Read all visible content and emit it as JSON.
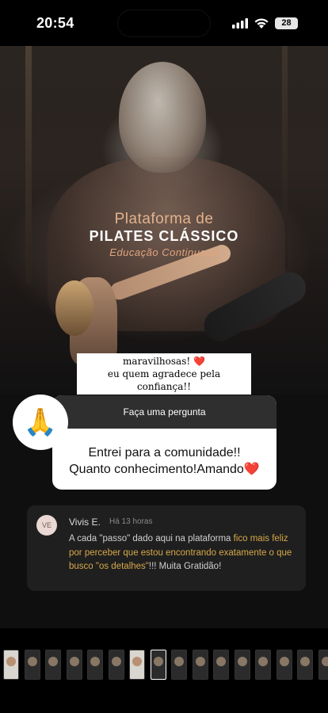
{
  "status_bar": {
    "time": "20:54",
    "battery": "28"
  },
  "story": {
    "brand": {
      "line1": "Plataforma de",
      "line2": "PILATES CLÁSSICO",
      "line3": "Educação Continuada"
    },
    "caption": {
      "line1": "maravilhosas! ❤️",
      "line2": "eu quem agradece pela confiança!!"
    },
    "question_sticker": {
      "avatar_emoji": "🙏",
      "header": "Faça uma pergunta",
      "answer_line1": "Entrei para a comunidade!!",
      "answer_line2": "Quanto conhecimento!Amando❤️"
    },
    "comment": {
      "avatar_initials": "VE",
      "author": "Vivis E.",
      "time": "Há 13 horas",
      "text_1": "A cada \"passo\" dado aqui na plataforma ",
      "text_highlight": "fico mais feliz por perceber que estou encontrando exatamente o que busco \"os detalhes\"",
      "text_2": "!!! Muita Gratidão!"
    }
  },
  "thumbnails": {
    "count": 16,
    "light_indices": [
      0,
      6
    ],
    "selected_index": 7
  }
}
